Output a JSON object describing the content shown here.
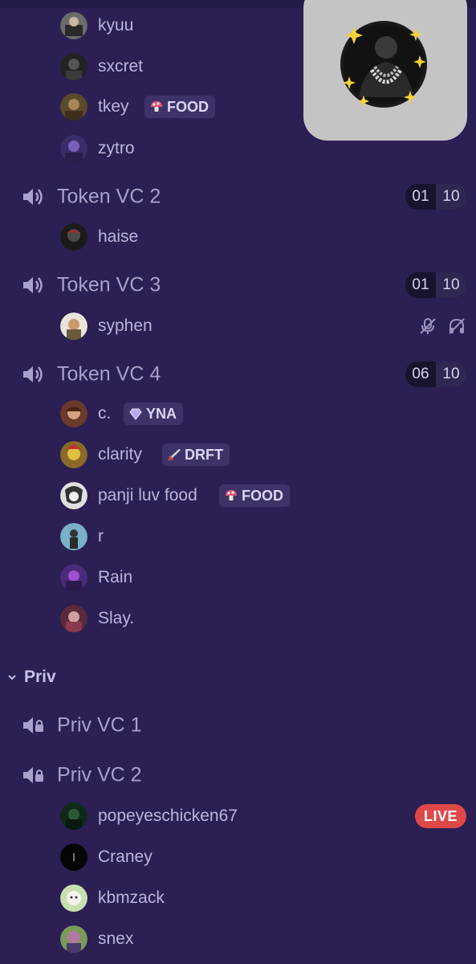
{
  "section_token_top": {
    "users": [
      {
        "name": "kyuu"
      },
      {
        "name": "sxcret"
      },
      {
        "name": "tkey",
        "tag": "FOOD",
        "tag_icon": "mushroom-icon"
      },
      {
        "name": "zytro"
      }
    ]
  },
  "channels": [
    {
      "name": "Token VC 2",
      "count": "01",
      "limit": "10"
    },
    {
      "name": "Token VC 3",
      "count": "01",
      "limit": "10"
    },
    {
      "name": "Token VC 4",
      "count": "06",
      "limit": "10"
    }
  ],
  "vc2_users": [
    {
      "name": "haise"
    }
  ],
  "vc3_users": [
    {
      "name": "syphen",
      "status_icons": [
        "mic-muted-icon",
        "deafened-icon"
      ]
    }
  ],
  "vc4_users": [
    {
      "name": "c.",
      "tag": "YNA",
      "tag_icon": "diamond-icon"
    },
    {
      "name": "clarity",
      "tag": "DRFT",
      "tag_icon": "sword-icon"
    },
    {
      "name": "panji luv food",
      "tag": "FOOD",
      "tag_icon": "mushroom-icon"
    },
    {
      "name": "r"
    },
    {
      "name": "Rain"
    },
    {
      "name": "Slay."
    }
  ],
  "category": {
    "label": "Priv",
    "icon": "chevron-down-icon"
  },
  "priv_channels": [
    {
      "name": "Priv VC 1",
      "icon": "locked-speaker-icon"
    },
    {
      "name": "Priv VC 2",
      "icon": "locked-speaker-icon"
    }
  ],
  "priv_vc2_users": [
    {
      "name": "popeyeschicken67",
      "badge": "LIVE"
    },
    {
      "name": "Craney"
    },
    {
      "name": "kbmzack"
    },
    {
      "name": "snex"
    }
  ],
  "colors": {
    "background": "#2b1f53",
    "tag_bg": "#3e3268",
    "live": "#e04848",
    "overlay": "#c4c4c4"
  }
}
